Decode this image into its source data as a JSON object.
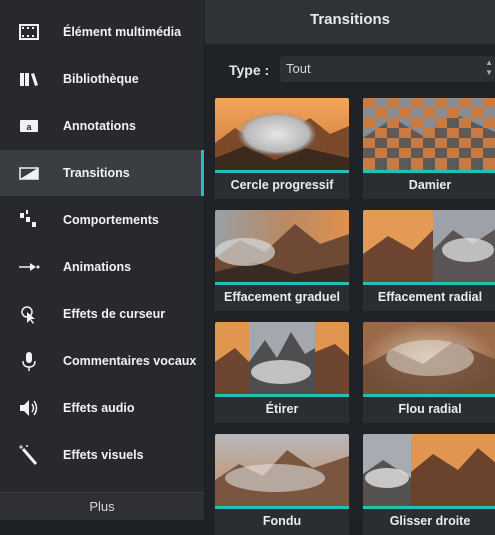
{
  "sidebar": {
    "items": [
      {
        "label": "Élément multimédia",
        "icon": "film-icon"
      },
      {
        "label": "Bibliothèque",
        "icon": "library-icon"
      },
      {
        "label": "Annotations",
        "icon": "annotation-icon"
      },
      {
        "label": "Transitions",
        "icon": "transition-icon",
        "active": true
      },
      {
        "label": "Comportements",
        "icon": "behaviors-icon"
      },
      {
        "label": "Animations",
        "icon": "animation-icon"
      },
      {
        "label": "Effets de curseur",
        "icon": "cursor-effects-icon"
      },
      {
        "label": "Commentaires vocaux",
        "icon": "microphone-icon"
      },
      {
        "label": "Effets audio",
        "icon": "speaker-icon"
      },
      {
        "label": "Effets visuels",
        "icon": "magic-wand-icon"
      }
    ],
    "more_label": "Plus"
  },
  "panel": {
    "title": "Transitions",
    "type_label": "Type :",
    "type_value": "Tout"
  },
  "transitions": [
    {
      "label": "Cercle progressif"
    },
    {
      "label": "Damier"
    },
    {
      "label": "Effacement graduel"
    },
    {
      "label": "Effacement radial"
    },
    {
      "label": "Étirer"
    },
    {
      "label": "Flou radial"
    },
    {
      "label": "Fondu"
    },
    {
      "label": "Glisser droite"
    }
  ],
  "colors": {
    "accent": "#1fc2b3",
    "sidebar_bg": "#27292d",
    "panel_bg": "#1f2226"
  }
}
